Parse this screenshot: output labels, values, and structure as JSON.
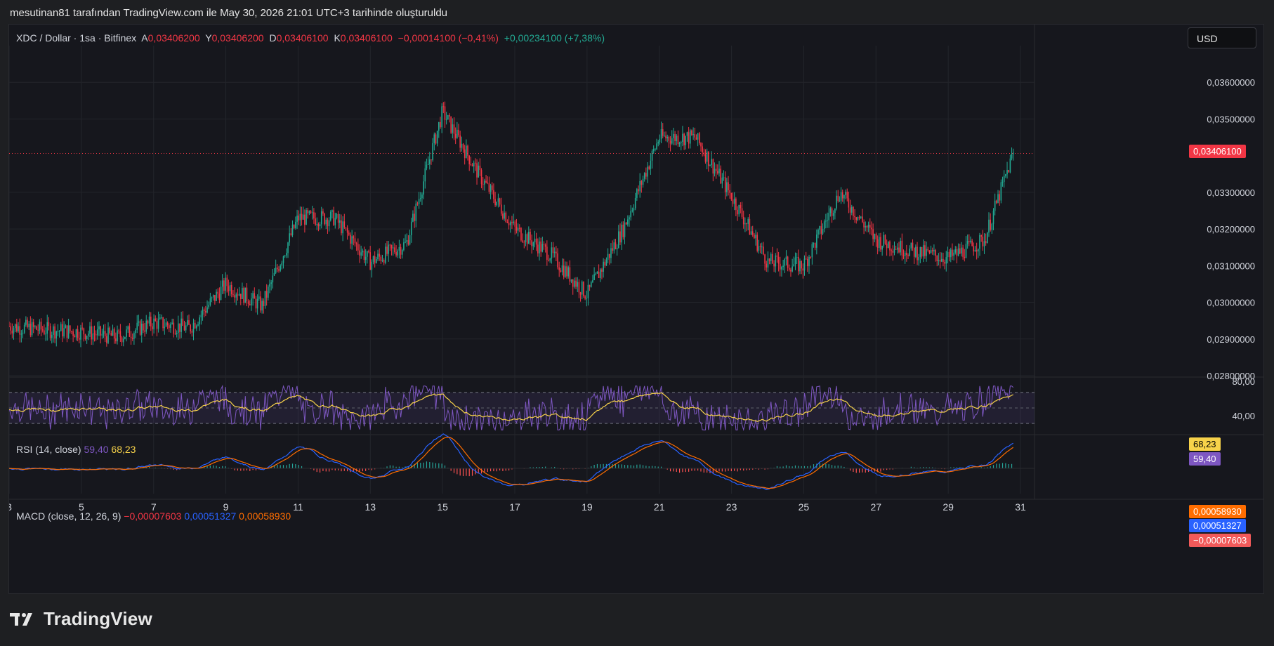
{
  "header": {
    "caption": "mesutinan81 tarafından TradingView.com ile May 30, 2026 21:01 UTC+3 tarihinde oluşturuldu"
  },
  "legend": {
    "symbol": "XDC / Dollar · 1sa · Bitfinex",
    "open_label": "A",
    "open_value": "0,03406200",
    "high_label": "Y",
    "high_value": "0,03406200",
    "low_label": "D",
    "low_value": "0,03406100",
    "close_label": "K",
    "close_value": "0,03406100",
    "change": "−0,00014100 (−0,41%)",
    "change_2": "+0,00234100 (+7,38%)"
  },
  "currency_button": "USD",
  "rsi": {
    "label": "RSI (14, close)",
    "value_1": "59,40",
    "value_2": "68,23",
    "tag_1": "68,23",
    "tag_2": "59,40",
    "axis_label": "40,00",
    "axis_top_label": "80,00"
  },
  "macd": {
    "label": "MACD (close, 12, 26, 9)",
    "histogram": "−0,00007603",
    "macd": "0,00051327",
    "signal": "0,00058930",
    "tag_signal": "0,00058930",
    "tag_macd": "0,00051327",
    "tag_hist": "−0,00007603"
  },
  "price_axis": {
    "ticks": [
      "0,03600000",
      "0,03500000",
      "0,03300000",
      "0,03200000",
      "0,03100000",
      "0,03000000",
      "0,02900000",
      "0,02800000"
    ],
    "last_price_tag": "0,03406100"
  },
  "time_axis": {
    "ticks": [
      "3",
      "5",
      "7",
      "9",
      "11",
      "13",
      "15",
      "17",
      "19",
      "21",
      "23",
      "25",
      "27",
      "29",
      "31"
    ]
  },
  "colors": {
    "up": "#22ab94",
    "down": "#f23645",
    "rsi_line": "#7e57c2",
    "rsi_ma": "#f7d24a",
    "macd_line": "#2962ff",
    "signal_line": "#ff6d00"
  },
  "logo": {
    "text": "TradingView"
  },
  "chart_data": {
    "type": "line",
    "title": "XDC / Dollar · 1sa · Bitfinex",
    "xlabel": "",
    "ylabel": "",
    "x": [
      3,
      4,
      5,
      6,
      7,
      8,
      9,
      10,
      11,
      12,
      13,
      14,
      15,
      16,
      17,
      18,
      19,
      20,
      21,
      22,
      23,
      24,
      25,
      26,
      27,
      28,
      29,
      30,
      30.8
    ],
    "series": [
      {
        "values": [
          0.02935,
          0.02925,
          0.0292,
          0.02905,
          0.02945,
          0.0293,
          0.0305,
          0.0299,
          0.0323,
          0.0323,
          0.0311,
          0.0316,
          0.0352,
          0.0335,
          0.032,
          0.0313,
          0.0302,
          0.032,
          0.0345,
          0.0345,
          0.0329,
          0.0311,
          0.031,
          0.033,
          0.0317,
          0.0314,
          0.0312,
          0.0317,
          0.03406
        ]
      }
    ],
    "ylim": [
      0.028,
      0.037
    ],
    "xlim": [
      3,
      31
    ],
    "grid": true
  }
}
